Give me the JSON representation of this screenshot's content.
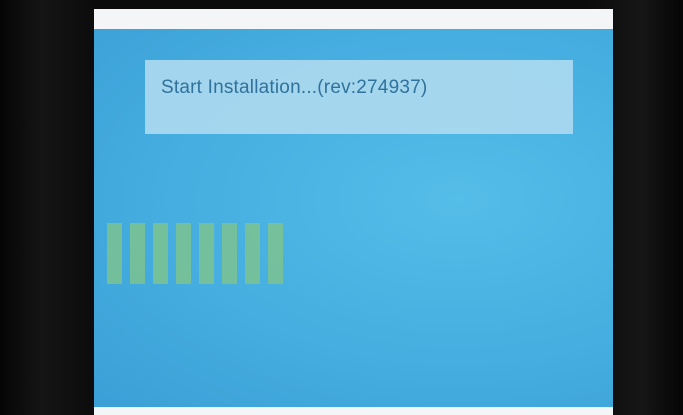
{
  "installer": {
    "message": "Start Installation...(rev:274937)",
    "progress_blocks": 8
  },
  "colors": {
    "screen_background": "#46aee0",
    "message_box": "#a9d9ef",
    "message_text": "#2f6f98",
    "progress_block": "#7cc38f"
  }
}
